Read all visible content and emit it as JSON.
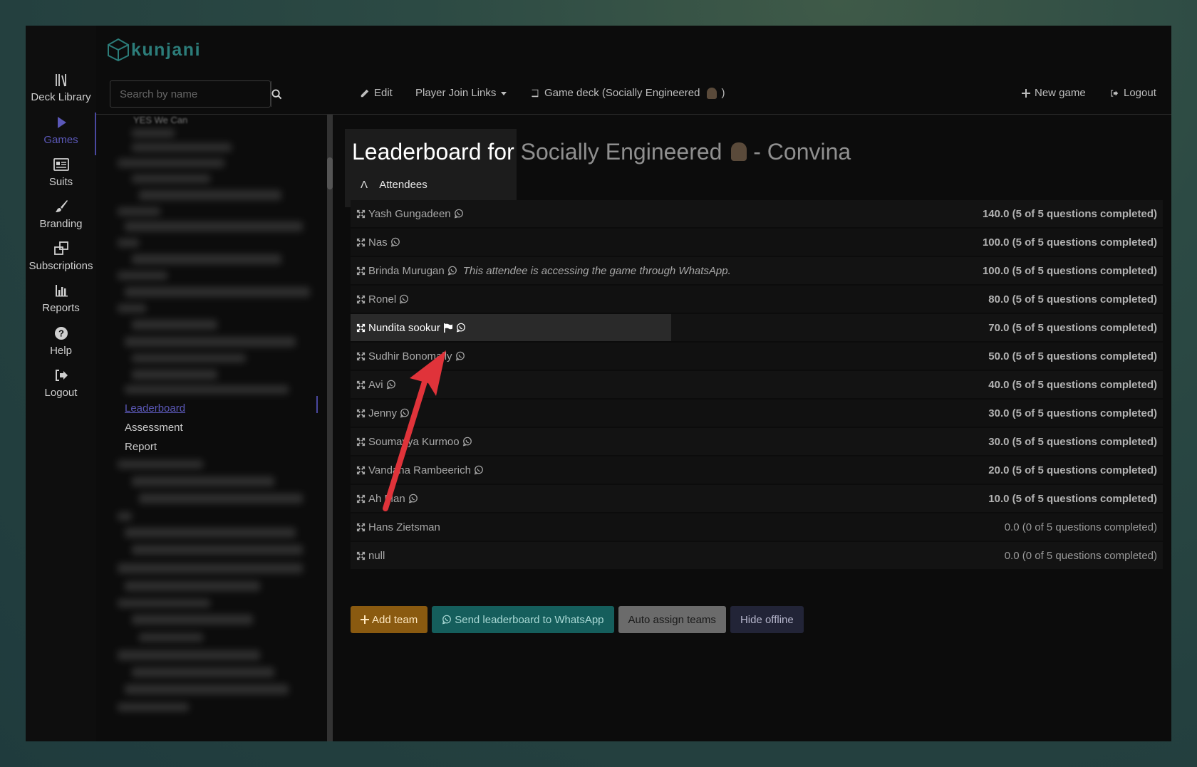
{
  "brand": {
    "name": "kunjani"
  },
  "rail": {
    "items": [
      {
        "label": "Deck Library",
        "icon": "library-icon"
      },
      {
        "label": "Games",
        "icon": "play-icon",
        "active": true
      },
      {
        "label": "Suits",
        "icon": "id-card-icon"
      },
      {
        "label": "Branding",
        "icon": "brush-icon"
      },
      {
        "label": "Subscriptions",
        "icon": "subscriptions-icon"
      },
      {
        "label": "Reports",
        "icon": "bar-chart-icon"
      },
      {
        "label": "Help",
        "icon": "help-icon"
      },
      {
        "label": "Logout",
        "icon": "logout-icon"
      }
    ]
  },
  "search": {
    "placeholder": "Search by name"
  },
  "topnav": {
    "edit": "Edit",
    "player_links": "Player Join Links",
    "game_deck": "Game deck (Socially Engineered",
    "game_deck_close": ")",
    "new_game": "New game",
    "logout": "Logout"
  },
  "tree": {
    "top_item": "YES We Can",
    "links": [
      "Leaderboard",
      "Assessment",
      "Report"
    ],
    "active": "Leaderboard"
  },
  "main": {
    "title_prefix": "Leaderboard for",
    "title_deck": "Socially Engineered",
    "title_suffix": "- Convina",
    "section": "Attendees",
    "whatsapp_note": "This attendee is accessing the game through WhatsApp."
  },
  "attendees": [
    {
      "name": "Yash Gungadeen",
      "score": "140.0 (5 of 5 questions completed)",
      "wa": true
    },
    {
      "name": "Nas",
      "score": "100.0 (5 of 5 questions completed)",
      "wa": true
    },
    {
      "name": "Brinda Murugan",
      "score": "100.0 (5 of 5 questions completed)",
      "wa": true,
      "note": true
    },
    {
      "name": "Ronel",
      "score": "80.0 (5 of 5 questions completed)",
      "wa": true
    },
    {
      "name": "Nundita sookur",
      "score": "70.0 (5 of 5 questions completed)",
      "wa": true,
      "flag": true,
      "highlight": true
    },
    {
      "name": "Sudhir Bonomally",
      "score": "50.0 (5 of 5 questions completed)",
      "wa": true
    },
    {
      "name": "Avi",
      "score": "40.0 (5 of 5 questions completed)",
      "wa": true
    },
    {
      "name": "Jenny",
      "score": "30.0 (5 of 5 questions completed)",
      "wa": true
    },
    {
      "name": "Soumayya Kurmoo",
      "score": "30.0 (5 of 5 questions completed)",
      "wa": true
    },
    {
      "name": "Vandana Rambeerich",
      "score": "20.0 (5 of 5 questions completed)",
      "wa": true
    },
    {
      "name": "Ah Man",
      "score": "10.0 (5 of 5 questions completed)",
      "wa": true
    },
    {
      "name": "Hans Zietsman",
      "score": "0.0 (0 of 5 questions completed)",
      "wa": false,
      "light": true
    },
    {
      "name": "null",
      "score": "0.0 (0 of 5 questions completed)",
      "wa": false,
      "light": true
    }
  ],
  "actions": {
    "add_team": "Add team",
    "send_whatsapp": "Send leaderboard to WhatsApp",
    "auto_assign": "Auto assign teams",
    "hide_offline": "Hide offline"
  },
  "colors": {
    "accent": "#5b58b8",
    "teal": "#2c7d7a",
    "annotation_arrow": "#e0333a"
  }
}
